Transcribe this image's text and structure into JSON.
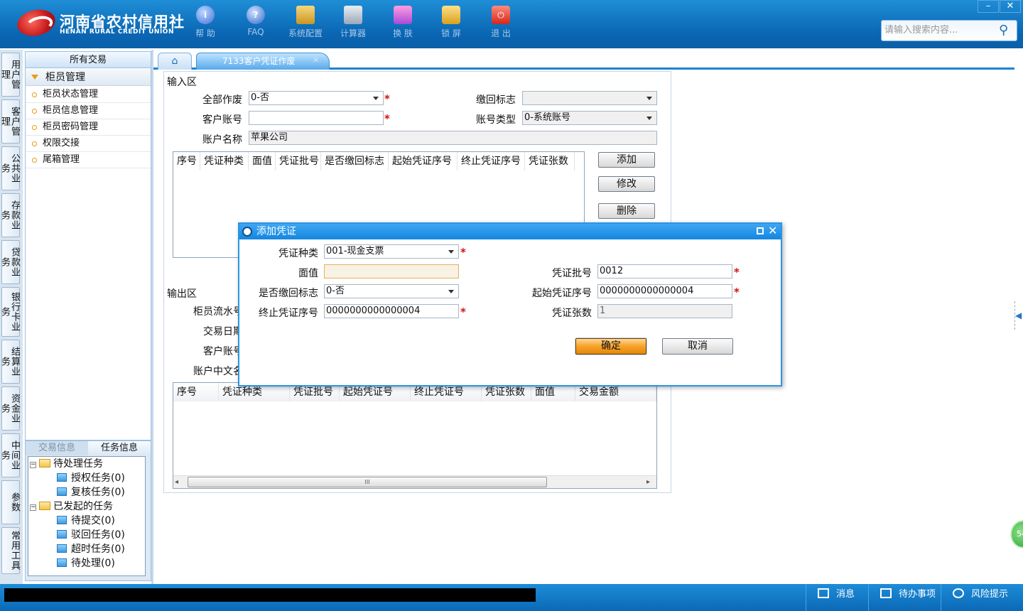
{
  "app": {
    "logo_cn": "河南省农村信用社",
    "logo_en": "HENAN RURAL CREDIT UNION",
    "toolbar": [
      {
        "label": "帮 助",
        "icon": "info-icon"
      },
      {
        "label": "FAQ",
        "icon": "question-icon"
      },
      {
        "label": "系统配置",
        "icon": "config-icon"
      },
      {
        "label": "计算器",
        "icon": "calculator-icon"
      },
      {
        "label": "换 肤",
        "icon": "skin-icon"
      },
      {
        "label": "锁 屏",
        "icon": "lock-icon"
      },
      {
        "label": "退 出",
        "icon": "power-icon"
      }
    ],
    "window_min": "–",
    "window_close": "✕",
    "search_placeholder": "请输入搜索内容..."
  },
  "left_rail": [
    "用户管理",
    "客户管理",
    "公共业务",
    "存款业务",
    "贷款业务",
    "银行卡业务",
    "结算业务",
    "资金业务",
    "中间业务",
    "参数",
    "常用工具"
  ],
  "nav": {
    "header": "所有交易",
    "group": "柜员管理",
    "items": [
      "柜员状态管理",
      "柜员信息管理",
      "柜员密码管理",
      "权限交接",
      "尾箱管理"
    ]
  },
  "task_panel": {
    "tab_tx": "交易信息",
    "tab_task": "任务信息",
    "tree": [
      {
        "label": "待处理任务",
        "type": "folder"
      },
      {
        "label": "授权任务(0)",
        "type": "leaf"
      },
      {
        "label": "复核任务(0)",
        "type": "leaf"
      },
      {
        "label": "已发起的任务",
        "type": "folder"
      },
      {
        "label": "待提交(0)",
        "type": "leaf"
      },
      {
        "label": "驳回任务(0)",
        "type": "leaf"
      },
      {
        "label": "超时任务(0)",
        "type": "leaf"
      },
      {
        "label": "待处理(0)",
        "type": "leaf"
      }
    ]
  },
  "tabs": {
    "home_icon": "⌂",
    "current": "7133客户凭证作废",
    "close": "✕"
  },
  "input_area": {
    "title": "输入区",
    "all_void_label": "全部作废",
    "all_void_value": "0-否",
    "recall_flag_label": "缴回标志",
    "recall_flag_value": "",
    "account_no_label": "客户账号",
    "account_no_value": "",
    "account_type_label": "账号类型",
    "account_type_value": "0-系统账号",
    "account_name_label": "账户名称",
    "account_name_value": "苹果公司",
    "grid_headers": [
      "序号",
      "凭证种类",
      "面值",
      "凭证批号",
      "是否缴回标志",
      "起始凭证序号",
      "终止凭证序号",
      "凭证张数"
    ],
    "add_button": "添加",
    "edit_button": "修改",
    "delete_button": "删除"
  },
  "output_area": {
    "title": "输出区",
    "teller_serial_label": "柜员流水号",
    "trade_date_label": "交易日期",
    "customer_account_label": "客户账号",
    "account_cn_name_label": "账户中文名",
    "grid_headers": [
      "序号",
      "凭证种类",
      "凭证批号",
      "起始凭证号",
      "终止凭证号",
      "凭证张数",
      "面值",
      "交易金额"
    ],
    "scroll_grip": "III",
    "scroll_left": "◂",
    "scroll_right": "▸"
  },
  "dialog": {
    "title": "添加凭证",
    "voucher_type_label": "凭证种类",
    "voucher_type_value": "001-现金支票",
    "face_value_label": "面值",
    "face_value_value": "",
    "batch_no_label": "凭证批号",
    "batch_no_value": "0012",
    "recall_flag_label": "是否缴回标志",
    "recall_flag_value": "0-否",
    "start_seq_label": "起始凭证序号",
    "start_seq_value": "0000000000000004",
    "end_seq_label": "终止凭证序号",
    "end_seq_value": "0000000000000004",
    "count_label": "凭证张数",
    "count_value": "1",
    "ok_button": "确定",
    "cancel_button": "取消",
    "close": "✕"
  },
  "status_bar": {
    "message": "消息",
    "todo": "待办事项",
    "risk": "风险提示"
  },
  "bubble_text": "54",
  "colors": {
    "topbar": "#0a66b3",
    "accent": "#1e83d0",
    "required": "#d01010",
    "ok_button": "#f6a226"
  }
}
